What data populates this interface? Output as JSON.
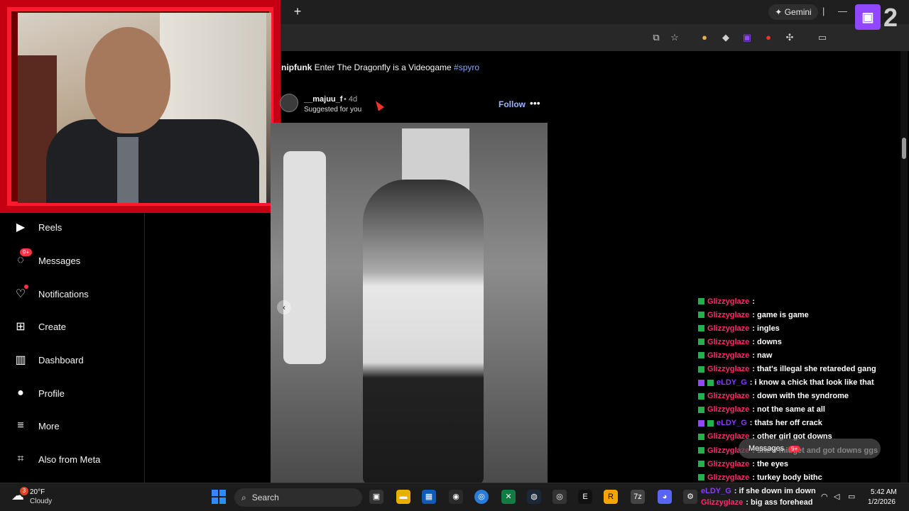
{
  "browser": {
    "new_tab": "+",
    "gemini_label": "Gemini"
  },
  "twitch_overlay": {
    "logo_text": "▣",
    "number": "2"
  },
  "instagram": {
    "nav": [
      {
        "label": "Reels",
        "icon": "reels-icon"
      },
      {
        "label": "Messages",
        "icon": "messenger-icon",
        "badge": "9+"
      },
      {
        "label": "Notifications",
        "icon": "heart-icon"
      },
      {
        "label": "Create",
        "icon": "plus-square-icon"
      },
      {
        "label": "Dashboard",
        "icon": "chart-icon"
      },
      {
        "label": "Profile",
        "icon": "avatar-icon"
      },
      {
        "label": "More",
        "icon": "hamburger-icon"
      },
      {
        "label": "Also from Meta",
        "icon": "meta-grid-icon"
      }
    ],
    "caption": {
      "user": "nipfunk",
      "text": "Enter The Dragonfly is a Videogame",
      "hashtag": "#spyro"
    },
    "post": {
      "username": "__majuu_f",
      "age": "• 4d",
      "suggested": "Suggested for you",
      "follow": "Follow",
      "more": "•••"
    }
  },
  "chat": [
    {
      "user": "Glizzyglaze",
      "msg": ":",
      "badges": 1,
      "alt": false
    },
    {
      "user": "Glizzyglaze",
      "msg": ": game is game",
      "badges": 1,
      "alt": false
    },
    {
      "user": "Glizzyglaze",
      "msg": ": ingles",
      "badges": 1,
      "alt": false
    },
    {
      "user": "Glizzyglaze",
      "msg": ": downs",
      "badges": 1,
      "alt": false
    },
    {
      "user": "Glizzyglaze",
      "msg": ": naw",
      "badges": 1,
      "alt": false
    },
    {
      "user": "Glizzyglaze",
      "msg": ": that's illegal she retareded gang",
      "badges": 1,
      "alt": false
    },
    {
      "user": "eLDY_G",
      "msg": ": i know a chick that look like that",
      "badges": 2,
      "alt": true
    },
    {
      "user": "Glizzyglaze",
      "msg": ": down with the syndrome",
      "badges": 1,
      "alt": false
    },
    {
      "user": "Glizzyglaze",
      "msg": ": not the same at all",
      "badges": 1,
      "alt": false
    },
    {
      "user": "eLDY_G",
      "msg": ": thats her off crack",
      "badges": 2,
      "alt": true
    },
    {
      "user": "Glizzyglaze",
      "msg": ": other girl got downs",
      "badges": 1,
      "alt": false
    },
    {
      "user": "Glizzyglaze",
      "msg": ": she's midget and got downs ggs",
      "badges": 1,
      "alt": false
    },
    {
      "user": "Glizzyglaze",
      "msg": ": the eyes",
      "badges": 1,
      "alt": false
    },
    {
      "user": "Glizzyglaze",
      "msg": ": turkey body bithc",
      "badges": 1,
      "alt": false
    }
  ],
  "toast": {
    "label": "Messages",
    "badge": "9+"
  },
  "bottom_chat": [
    {
      "user": "eLDY_G",
      "msg": ": if she down im down"
    },
    {
      "user": "Glizzyglaze",
      "msg": ": big ass forehead"
    }
  ],
  "taskbar": {
    "weather_temp": "20°F",
    "weather_cond": "Cloudy",
    "weather_badge": "3",
    "search": "Search",
    "time": "5:42 AM",
    "date": "1/2/2026"
  }
}
